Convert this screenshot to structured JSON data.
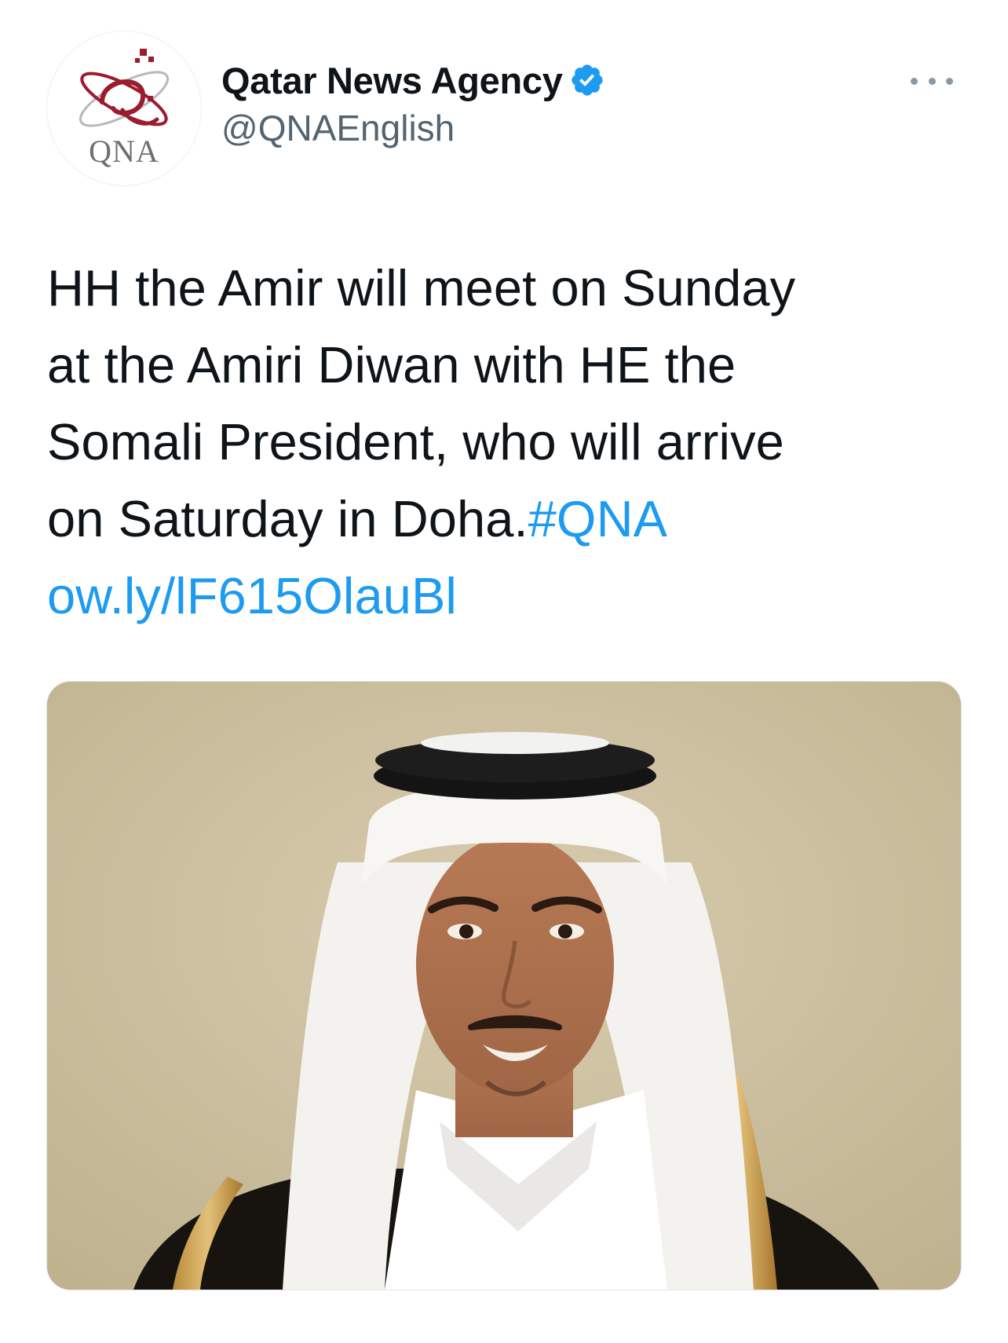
{
  "author": {
    "display_name": "Qatar News Agency",
    "handle": "@QNAEnglish",
    "verified": true,
    "avatar_logo_text": "QNA",
    "avatar_icon": "qna-logo-icon",
    "verified_icon": "verified-badge-icon",
    "more_icon": "more-options-icon"
  },
  "tweet": {
    "lines": [
      "HH the Amir will meet on Sunday",
      "at the Amiri Diwan with HE the",
      "Somali President, who will arrive",
      "on Saturday in Doha."
    ],
    "hashtag": "#QNA",
    "link": "ow.ly/lF615OlauBl"
  },
  "media": {
    "type": "photo",
    "icon": "portrait-photo-icon"
  },
  "colors": {
    "link": "#1d9bf0",
    "text": "#0f1419",
    "secondary": "#536471",
    "verified": "#1d9bf0",
    "logo_red": "#9c1b2e"
  }
}
